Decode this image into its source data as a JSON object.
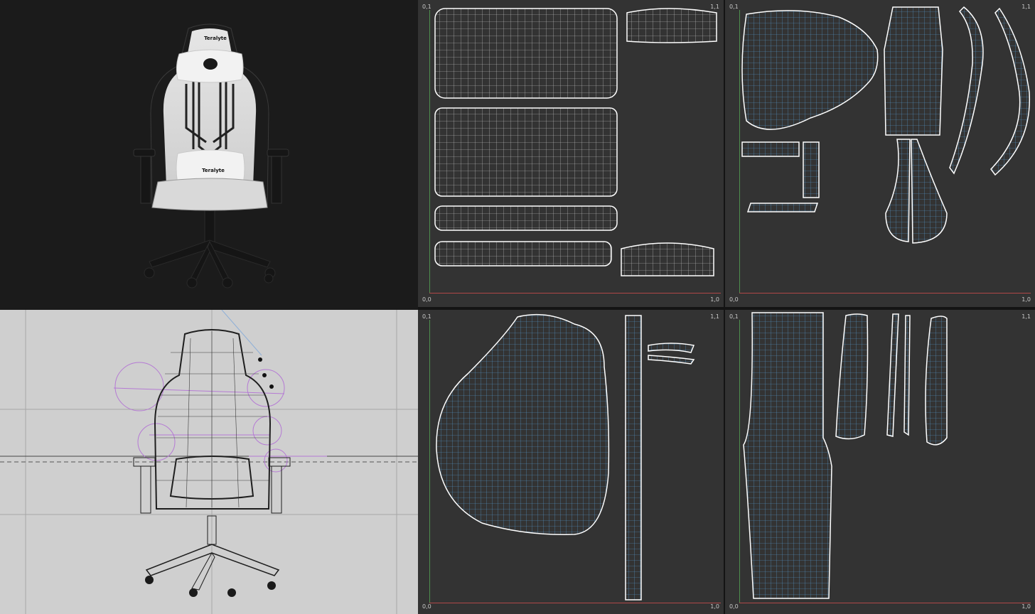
{
  "colors": {
    "uv_background": "#333333",
    "uv_white_shell": "#ffffff",
    "uv_blue_shell": "#5a9fd6",
    "render_background": "#1b1b1b",
    "viewport_background": "#cfcfcf"
  },
  "render": {
    "brand_logo": "Teralyte",
    "brand_logo_lumbar": "Teralyte"
  },
  "uv_windows": [
    {
      "top_left": "0,1",
      "top_right": "1,1",
      "bottom_left": "0,0",
      "bottom_right": "1,0"
    },
    {
      "top_left": "0,1",
      "top_right": "1,1",
      "bottom_left": "0,0",
      "bottom_right": "1,0"
    },
    {
      "top_left": "0,1",
      "top_right": "1,1",
      "bottom_left": "0,0",
      "bottom_right": "1,0"
    },
    {
      "top_left": "0,1",
      "top_right": "1,1",
      "bottom_left": "0,0",
      "bottom_right": "1,0"
    }
  ]
}
